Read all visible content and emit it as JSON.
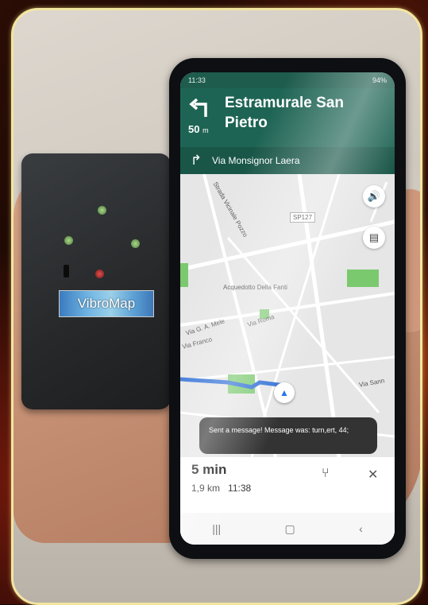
{
  "device": {
    "label": "VibroMap"
  },
  "phone": {
    "status": {
      "time": "11:33",
      "battery": "94%"
    },
    "navigation": {
      "street": "Estramurale San Pietro",
      "distance_value": "50",
      "distance_unit": "m",
      "next_street": "Via Monsignor Laera"
    },
    "map": {
      "road_badge": "SP127",
      "labels": [
        "Strada Vicinale Pozzo",
        "Acquedotto Della Fanti",
        "Via Roma",
        "Via G. A. Mele",
        "Via Sann",
        "Via Franco"
      ]
    },
    "toast": "Sent a message! Message was: turn,ert, 44;",
    "eta": {
      "duration": "5 min",
      "distance": "1,9 km",
      "arrival": "11:38"
    }
  }
}
